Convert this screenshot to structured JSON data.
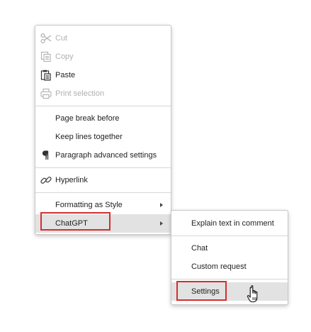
{
  "context_menu": {
    "items": {
      "cut": "Cut",
      "copy": "Copy",
      "paste": "Paste",
      "print_selection": "Print selection",
      "page_break_before": "Page break before",
      "keep_lines_together": "Keep lines together",
      "paragraph_advanced_settings": "Paragraph advanced settings",
      "hyperlink": "Hyperlink",
      "formatting_as_style": "Formatting as Style",
      "chatgpt": "ChatGPT"
    }
  },
  "chatgpt_submenu": {
    "items": {
      "explain_text_in_comment": "Explain text in comment",
      "chat": "Chat",
      "custom_request": "Custom request",
      "settings": "Settings"
    }
  },
  "icons": {
    "cut": "scissors-icon",
    "copy": "copy-icon",
    "paste": "paste-icon",
    "print_selection": "printer-icon",
    "paragraph_advanced_settings": "pilcrow-icon",
    "hyperlink": "link-icon",
    "cursor": "hand-pointer-icon"
  },
  "colors": {
    "highlight_border": "#d32f2f",
    "hover_background": "#e2e2e2",
    "disabled_text": "#b0b0b0",
    "text": "#222222"
  }
}
